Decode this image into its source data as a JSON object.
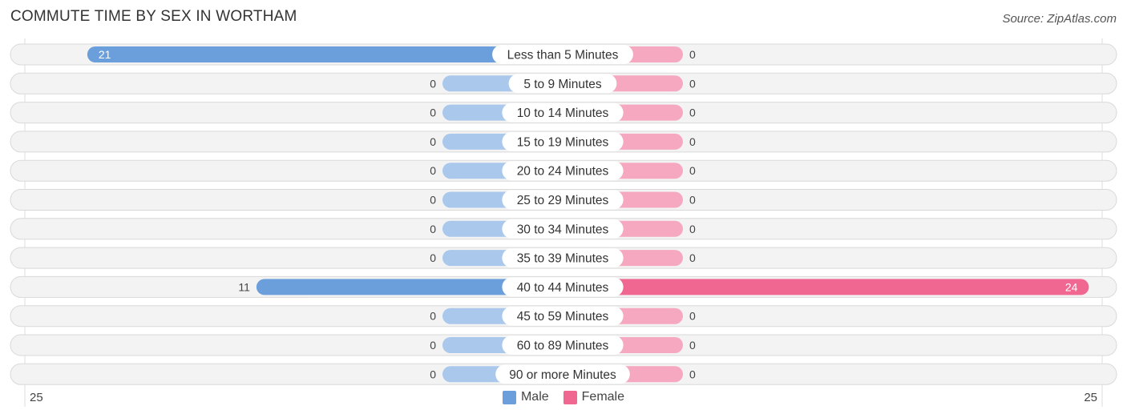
{
  "chart_data": {
    "type": "bar",
    "orientation": "horizontal-diverging",
    "title": "COMMUTE TIME BY SEX IN WORTHAM",
    "source": "Source: ZipAtlas.com",
    "categories": [
      "Less than 5 Minutes",
      "5 to 9 Minutes",
      "10 to 14 Minutes",
      "15 to 19 Minutes",
      "20 to 24 Minutes",
      "25 to 29 Minutes",
      "30 to 34 Minutes",
      "35 to 39 Minutes",
      "40 to 44 Minutes",
      "45 to 59 Minutes",
      "60 to 89 Minutes",
      "90 or more Minutes"
    ],
    "series": [
      {
        "name": "Male",
        "color": "#6a9fdb",
        "light_color": "#aac8ec",
        "values": [
          21,
          0,
          0,
          0,
          0,
          0,
          0,
          0,
          11,
          0,
          0,
          0
        ]
      },
      {
        "name": "Female",
        "color": "#f06892",
        "light_color": "#f5a8c0",
        "values": [
          0,
          0,
          0,
          0,
          0,
          0,
          0,
          0,
          24,
          0,
          0,
          0
        ]
      }
    ],
    "axis": {
      "left_label": "25",
      "right_label": "25",
      "max": 25
    },
    "legend": {
      "position": "bottom-center",
      "items": [
        "Male",
        "Female"
      ]
    }
  }
}
